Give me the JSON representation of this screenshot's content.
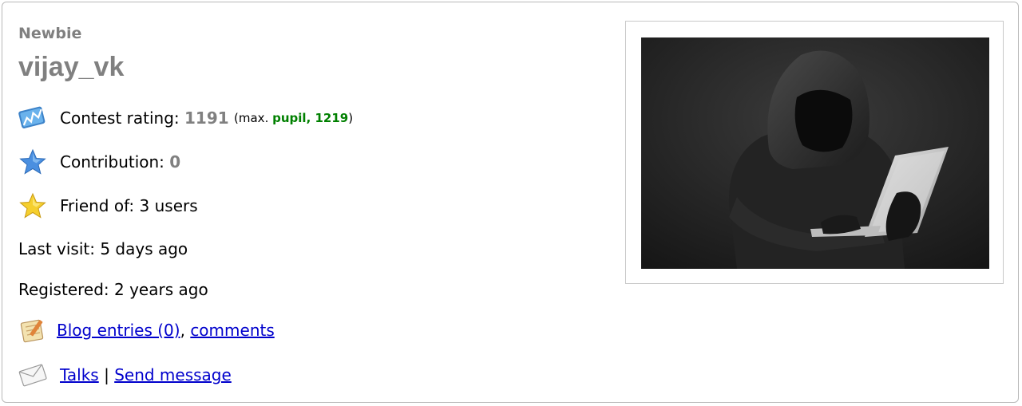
{
  "profile": {
    "rank": "Newbie",
    "handle": "vijay_vk",
    "contest_rating_label": "Contest rating:",
    "contest_rating_value": "1191",
    "max_prefix": "(max.",
    "max_rank": "pupil",
    "max_rating": "1219",
    "max_suffix": ")",
    "contribution_label": "Contribution:",
    "contribution_value": "0",
    "friend_of_label": "Friend of:",
    "friend_of_value": "3 users",
    "last_visit_label": "Last visit:",
    "last_visit_value": "5 days ago",
    "registered_label": "Registered:",
    "registered_value": "2 years ago",
    "blog_entries_link": "Blog entries (0)",
    "comments_link": "comments",
    "talks_link": "Talks",
    "send_message_link": "Send message"
  },
  "icons": {
    "rating": "rating-chart-icon",
    "contribution": "blue-star-icon",
    "friends": "yellow-star-icon",
    "blog": "blog-notepad-icon",
    "talks": "envelope-icon"
  },
  "colors": {
    "rank_gray": "#808080",
    "pupil_green": "#008000",
    "link_blue": "#0000cc"
  }
}
